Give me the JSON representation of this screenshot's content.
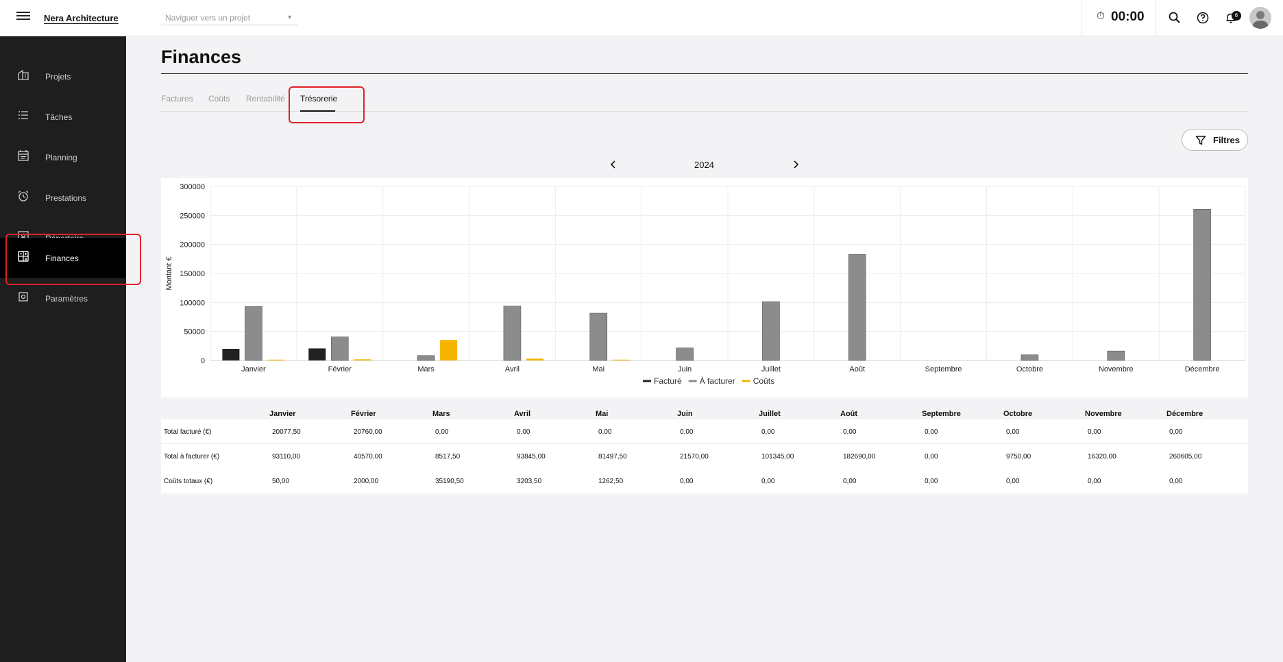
{
  "app": {
    "brand": "Nera Architecture"
  },
  "topbar": {
    "project_placeholder": "Naviguer vers un projet",
    "timer": "00:00",
    "notifications_count": "6",
    "icons": [
      "menu-icon",
      "stopwatch-icon",
      "search-icon",
      "help-icon",
      "bell-icon",
      "avatar"
    ]
  },
  "sidebar": {
    "items": [
      {
        "label": "Projets",
        "icon": "building-icon"
      },
      {
        "label": "Tâches",
        "icon": "list-icon"
      },
      {
        "label": "Planning",
        "icon": "calendar-icon"
      },
      {
        "label": "Prestations",
        "icon": "alarm-clock-icon"
      },
      {
        "label": "Répertoire",
        "icon": "contact-card-icon"
      },
      {
        "label": "Finances",
        "icon": "calculator-icon",
        "active": true
      },
      {
        "label": "Paramètres",
        "icon": "settings-icon"
      }
    ]
  },
  "page": {
    "title": "Finances"
  },
  "tabs": [
    {
      "label": "Factures"
    },
    {
      "label": "Coûts"
    },
    {
      "label": "Rentabilité"
    },
    {
      "label": "Trésorerie",
      "active": true
    }
  ],
  "filters": {
    "label": "Filtres"
  },
  "year_nav": {
    "year": "2024"
  },
  "chart_data": {
    "type": "bar",
    "categories": [
      "Janvier",
      "Février",
      "Mars",
      "Avril",
      "Mai",
      "Juin",
      "Juillet",
      "Août",
      "Septembre",
      "Octobre",
      "Novembre",
      "Décembre"
    ],
    "series": [
      {
        "name": "Facturé",
        "color": "#222222",
        "values": [
          20077.5,
          20760,
          0,
          0,
          0,
          0,
          0,
          0,
          0,
          0,
          0,
          0
        ]
      },
      {
        "name": "À facturer",
        "color": "#8c8c8c",
        "values": [
          93110,
          40570,
          8517.5,
          93845,
          81497.5,
          21570,
          101345,
          182690,
          0,
          9750,
          16320,
          260605
        ]
      },
      {
        "name": "Coûts",
        "color": "#f5b400",
        "values": [
          50,
          2000,
          35190.5,
          3203.5,
          1262.5,
          0,
          0,
          0,
          0,
          0,
          0,
          0
        ]
      }
    ],
    "ylabel": "Montant €",
    "ylim": [
      0,
      300000
    ],
    "yticks": [
      "0",
      "50000",
      "100000",
      "150000",
      "200000",
      "250000",
      "300000"
    ],
    "grid": true,
    "legend": "bottom"
  },
  "table": {
    "columns": [
      "Janvier",
      "Février",
      "Mars",
      "Avril",
      "Mai",
      "Juin",
      "Juillet",
      "Août",
      "Septembre",
      "Octobre",
      "Novembre",
      "Décembre"
    ],
    "rows": [
      {
        "label": "Total facturé (€)",
        "cells": [
          "20077,50",
          "20760,00",
          "0,00",
          "0,00",
          "0,00",
          "0,00",
          "0,00",
          "0,00",
          "0,00",
          "0,00",
          "0,00",
          "0,00"
        ]
      },
      {
        "label": "Total à facturer (€)",
        "cells": [
          "93110,00",
          "40570,00",
          "8517,50",
          "93845,00",
          "81497,50",
          "21570,00",
          "101345,00",
          "182690,00",
          "0,00",
          "9750,00",
          "16320,00",
          "260605,00"
        ]
      },
      {
        "label": "Coûts totaux (€)",
        "cells": [
          "50,00",
          "2000,00",
          "35190,50",
          "3203,50",
          "1262,50",
          "0,00",
          "0,00",
          "0,00",
          "0,00",
          "0,00",
          "0,00",
          "0,00"
        ]
      }
    ]
  }
}
